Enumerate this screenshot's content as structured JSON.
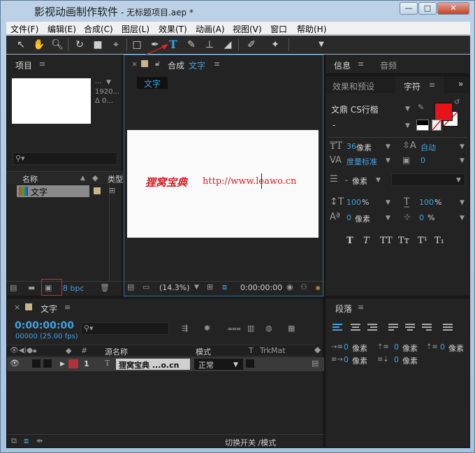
{
  "window": {
    "title_app": "影视动画制作软件",
    "title_doc": " - 无标题项目.aep *",
    "btn_min": "—",
    "btn_max": "□",
    "btn_close": "✕"
  },
  "menu": [
    "文件(F)",
    "编辑(E)",
    "合成(C)",
    "图层(L)",
    "效果(T)",
    "动画(A)",
    "视图(V)",
    "窗口",
    "帮助(H)"
  ],
  "toolbar": {
    "tools": [
      "selection-tool",
      "hand-tool",
      "zoom-tool",
      "rotation-tool",
      "camera-tool",
      "pan-behind-tool",
      "rectangle-tool",
      "pen-tool",
      "type-tool",
      "brush-tool",
      "clone-stamp-tool",
      "eraser-tool",
      "roto-brush-tool",
      "puppet-tool"
    ],
    "type_glyph": "T"
  },
  "project": {
    "tab": "项目",
    "menu": "≡",
    "thumb_info": "1920...",
    "thumb_info2": "Δ 0...",
    "thumb_dots": "...",
    "search_placeholder": "",
    "col_name": "名称",
    "col_type": "类型",
    "item_name": "文字",
    "bpc": "8 bpc"
  },
  "composition": {
    "tab_prefix": "合成",
    "tab_name": "文字",
    "menu": "≡",
    "breadcrumb": "文字",
    "canvas_text_left": "狸窝宝典",
    "canvas_text_right": "http://www.leawo.cn",
    "zoom": "(14.3%)",
    "timecode": "0:00:00:00"
  },
  "info_panel": {
    "tab_info": "信息",
    "tab_audio": "音频",
    "menu": "≡"
  },
  "effects_panel": {
    "tab_effects": "效果和预设",
    "tab_char": "字符",
    "menu": "≡",
    "expand": "»"
  },
  "character": {
    "font_family": "文鼎 CS行楷",
    "font_style": "-",
    "size_value": "36",
    "size_unit": "像素",
    "leading_value": "自动",
    "kerning": "度量标准",
    "tracking_value": "0",
    "stroke_width": "-",
    "stroke_unit": "像素",
    "vscale": "100",
    "hscale": "100",
    "pct": "%",
    "baseline": "0",
    "baseline_unit": "像素",
    "tsume": "0",
    "tsume_unit": "%",
    "fill_color": "#e8131a",
    "stroke_color": "#ffffff",
    "format_buttons": [
      "T",
      "T",
      "TT",
      "Tт",
      "T¹",
      "T₁"
    ]
  },
  "paragraph": {
    "tab": "段落",
    "menu": "≡",
    "indent_left": "0",
    "indent_right": "0",
    "indent_first": "0",
    "space_before": "0",
    "space_after": "0",
    "unit": "像素"
  },
  "timeline": {
    "comp_name": "文字",
    "menu": "≡",
    "timecode": "0:00:00:00",
    "fps": "00000 (25.00 fps)",
    "col_hash": "#",
    "col_source": "源名称",
    "col_mode": "模式",
    "col_t": "T",
    "col_trkmat": "TrkMat",
    "layer_index": "1",
    "layer_type": "T",
    "layer_name": "狸窝宝典 ...o.cn",
    "layer_mode": "正常",
    "footer_toggle": "切换开关 /模式"
  }
}
